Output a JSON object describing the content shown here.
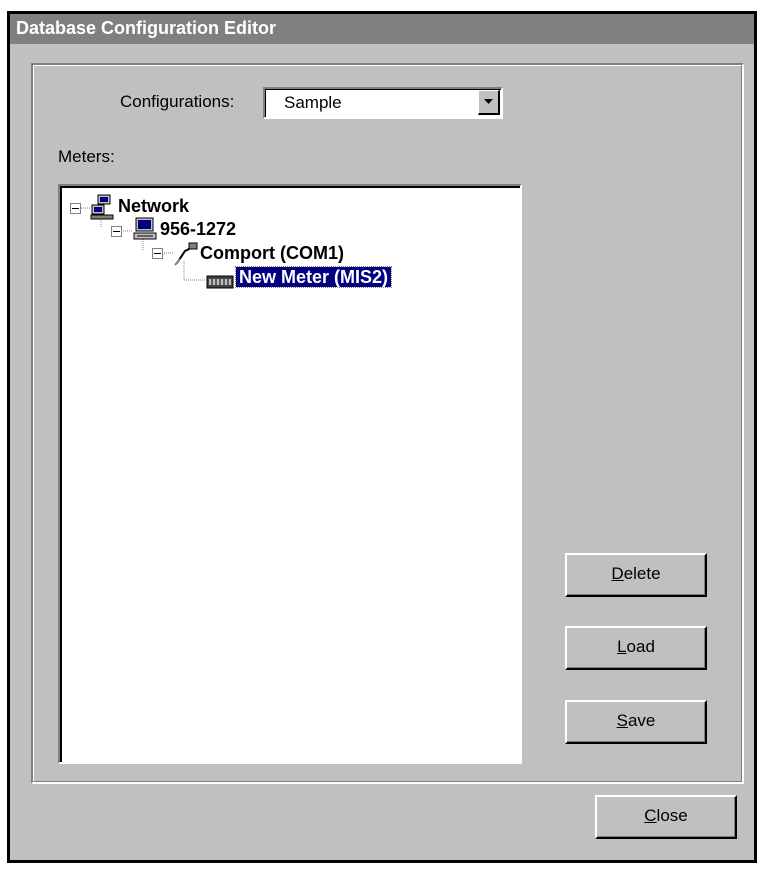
{
  "window": {
    "title": "Database Configuration Editor"
  },
  "configurations": {
    "label": "Configurations:",
    "selected": "Sample"
  },
  "meters": {
    "label": "Meters:",
    "tree": [
      {
        "label": "Network",
        "icon": "network-icon",
        "level": 0
      },
      {
        "label": "956-1272",
        "icon": "computer-icon",
        "level": 1
      },
      {
        "label": "Comport (COM1)",
        "icon": "comport-icon",
        "level": 2
      },
      {
        "label": "New Meter (MIS2)",
        "icon": "meter-icon",
        "level": 3,
        "selected": true
      }
    ]
  },
  "buttons": {
    "delete_mnemonic": "D",
    "delete_rest": "elete",
    "load_mnemonic": "L",
    "load_rest": "oad",
    "save_mnemonic": "S",
    "save_rest": "ave",
    "close_mnemonic": "C",
    "close_rest": "lose"
  }
}
